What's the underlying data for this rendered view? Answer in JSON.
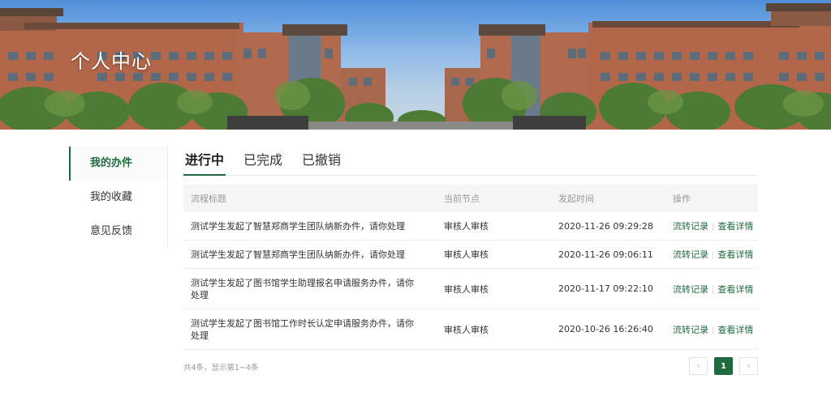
{
  "banner": {
    "title": "个人中心"
  },
  "sidebar": {
    "items": [
      {
        "label": "我的办件",
        "active": true
      },
      {
        "label": "我的收藏",
        "active": false
      },
      {
        "label": "意见反馈",
        "active": false
      }
    ]
  },
  "tabs": [
    {
      "label": "进行中",
      "active": true
    },
    {
      "label": "已完成",
      "active": false
    },
    {
      "label": "已撤销",
      "active": false
    }
  ],
  "table": {
    "headers": [
      "流程标题",
      "当前节点",
      "发起时间",
      "操作"
    ],
    "rows": [
      {
        "title": "测试学生发起了智慧郑商学生团队纳新办件，请你处理",
        "node": "审核人审核",
        "time": "2020-11-26 09:29:28",
        "action1": "流转记录",
        "action2": "查看详情"
      },
      {
        "title": "测试学生发起了智慧郑商学生团队纳新办件，请你处理",
        "node": "审核人审核",
        "time": "2020-11-26 09:06:11",
        "action1": "流转记录",
        "action2": "查看详情"
      },
      {
        "title": "测试学生发起了图书馆学生助理报名申请服务办件，请你处理",
        "node": "审核人审核",
        "time": "2020-11-17 09:22:10",
        "action1": "流转记录",
        "action2": "查看详情"
      },
      {
        "title": "测试学生发起了图书馆工作时长认定申请服务办件，请你处理",
        "node": "审核人审核",
        "time": "2020-10-26 16:26:40",
        "action1": "流转记录",
        "action2": "查看详情"
      }
    ]
  },
  "footer": {
    "count_text": "共4条，显示第1~4条"
  },
  "pagination": {
    "prev": "‹",
    "current": "1",
    "next": "›"
  },
  "colors": {
    "accent": "#1e6b3f",
    "header_bg": "#f5f5f5",
    "muted_text": "#999999"
  },
  "icons": {
    "prev": "chevron-left-icon",
    "next": "chevron-right-icon"
  }
}
